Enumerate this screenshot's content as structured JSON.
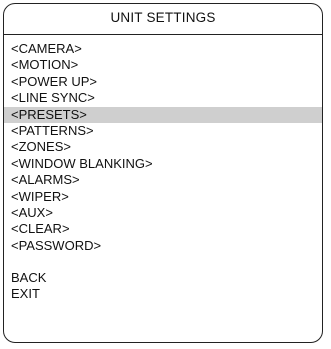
{
  "panel": {
    "title": "UNIT SETTINGS",
    "selection_color": "#cfcfcf"
  },
  "menu": {
    "items": [
      {
        "label": "<CAMERA>",
        "selected": false
      },
      {
        "label": "<MOTION>",
        "selected": false
      },
      {
        "label": "<POWER UP>",
        "selected": false
      },
      {
        "label": "<LINE SYNC>",
        "selected": false
      },
      {
        "label": "<PRESETS>",
        "selected": true
      },
      {
        "label": "<PATTERNS>",
        "selected": false
      },
      {
        "label": "<ZONES>",
        "selected": false
      },
      {
        "label": "<WINDOW BLANKING>",
        "selected": false
      },
      {
        "label": "<ALARMS>",
        "selected": false
      },
      {
        "label": "<WIPER>",
        "selected": false
      },
      {
        "label": "<AUX>",
        "selected": false
      },
      {
        "label": "<CLEAR>",
        "selected": false
      },
      {
        "label": "<PASSWORD>",
        "selected": false
      }
    ],
    "footer": [
      {
        "label": "BACK"
      },
      {
        "label": "EXIT"
      }
    ]
  }
}
